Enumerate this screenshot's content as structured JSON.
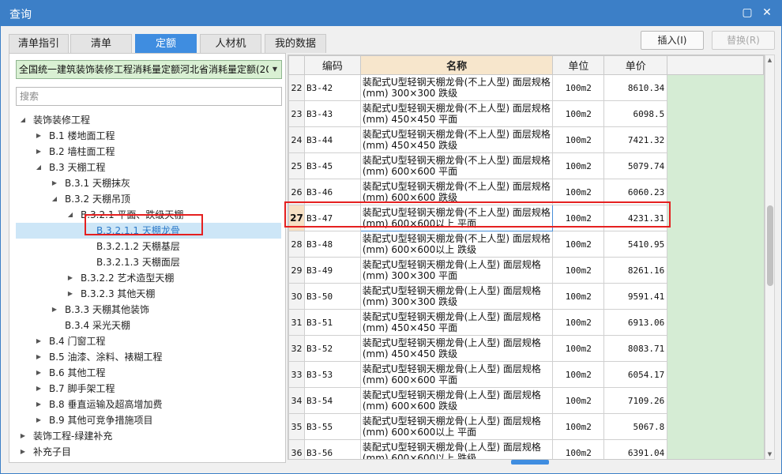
{
  "window": {
    "title": "查询",
    "restore_icon": "▢",
    "close_icon": "✕"
  },
  "tabs": [
    {
      "label": "清单指引",
      "active": false
    },
    {
      "label": "清单",
      "active": false
    },
    {
      "label": "定额",
      "active": true
    },
    {
      "label": "人材机",
      "active": false
    },
    {
      "label": "我的数据",
      "active": false
    }
  ],
  "actions": {
    "insert": "插入(I)",
    "replace": "替换(R)"
  },
  "left": {
    "library": "全国统一建筑装饰装修工程消耗量定额河北省消耗量定额(20",
    "search_placeholder": "搜索"
  },
  "tree": [
    {
      "label": "装饰装修工程",
      "level": 0,
      "state": "expanded"
    },
    {
      "label": "B.1 楼地面工程",
      "level": 1,
      "state": "collapsed"
    },
    {
      "label": "B.2 墙柱面工程",
      "level": 1,
      "state": "collapsed"
    },
    {
      "label": "B.3 天棚工程",
      "level": 1,
      "state": "expanded"
    },
    {
      "label": "B.3.1 天棚抹灰",
      "level": 2,
      "state": "collapsed"
    },
    {
      "label": "B.3.2 天棚吊顶",
      "level": 2,
      "state": "expanded"
    },
    {
      "label": "B.3.2.1 平面、跌级天棚",
      "level": 3,
      "state": "expanded"
    },
    {
      "label": "B.3.2.1.1 天棚龙骨",
      "level": 4,
      "state": "leaf",
      "selected": true
    },
    {
      "label": "B.3.2.1.2 天棚基层",
      "level": 4,
      "state": "leaf"
    },
    {
      "label": "B.3.2.1.3 天棚面层",
      "level": 4,
      "state": "leaf"
    },
    {
      "label": "B.3.2.2 艺术造型天棚",
      "level": 3,
      "state": "collapsed"
    },
    {
      "label": "B.3.2.3 其他天棚",
      "level": 3,
      "state": "collapsed"
    },
    {
      "label": "B.3.3 天棚其他装饰",
      "level": 2,
      "state": "collapsed"
    },
    {
      "label": "B.3.4 采光天棚",
      "level": 2,
      "state": "leaf"
    },
    {
      "label": "B.4 门窗工程",
      "level": 1,
      "state": "collapsed"
    },
    {
      "label": "B.5 油漆、涂料、裱糊工程",
      "level": 1,
      "state": "collapsed"
    },
    {
      "label": "B.6 其他工程",
      "level": 1,
      "state": "collapsed"
    },
    {
      "label": "B.7 脚手架工程",
      "level": 1,
      "state": "collapsed"
    },
    {
      "label": "B.8 垂直运输及超高增加费",
      "level": 1,
      "state": "collapsed"
    },
    {
      "label": "B.9 其他可竞争措施项目",
      "level": 1,
      "state": "collapsed"
    },
    {
      "label": "装饰工程-绿建补充",
      "level": 0,
      "state": "collapsed"
    },
    {
      "label": "补充子目",
      "level": 0,
      "state": "collapsed"
    }
  ],
  "grid": {
    "columns": {
      "code": "编码",
      "name": "名称",
      "unit": "单位",
      "price": "单价"
    },
    "rows": [
      {
        "idx": "22",
        "code": "B3-42",
        "name": "装配式U型轻钢天棚龙骨(不上人型) 面层规格(mm) 300×300 跌级",
        "unit": "100m2",
        "price": "8610.34"
      },
      {
        "idx": "23",
        "code": "B3-43",
        "name": "装配式U型轻钢天棚龙骨(不上人型) 面层规格(mm) 450×450 平面",
        "unit": "100m2",
        "price": "6098.5"
      },
      {
        "idx": "24",
        "code": "B3-44",
        "name": "装配式U型轻钢天棚龙骨(不上人型) 面层规格(mm) 450×450 跌级",
        "unit": "100m2",
        "price": "7421.32"
      },
      {
        "idx": "25",
        "code": "B3-45",
        "name": "装配式U型轻钢天棚龙骨(不上人型) 面层规格(mm) 600×600 平面",
        "unit": "100m2",
        "price": "5079.74"
      },
      {
        "idx": "26",
        "code": "B3-46",
        "name": "装配式U型轻钢天棚龙骨(不上人型) 面层规格(mm) 600×600 跌级",
        "unit": "100m2",
        "price": "6060.23"
      },
      {
        "idx": "27",
        "code": "B3-47",
        "name": "装配式U型轻钢天棚龙骨(不上人型) 面层规格(mm) 600×600以上 平面",
        "unit": "100m2",
        "price": "4231.31",
        "current": true
      },
      {
        "idx": "28",
        "code": "B3-48",
        "name": "装配式U型轻钢天棚龙骨(不上人型) 面层规格(mm) 600×600以上 跌级",
        "unit": "100m2",
        "price": "5410.95"
      },
      {
        "idx": "29",
        "code": "B3-49",
        "name": "装配式U型轻钢天棚龙骨(上人型) 面层规格(mm) 300×300 平面",
        "unit": "100m2",
        "price": "8261.16"
      },
      {
        "idx": "30",
        "code": "B3-50",
        "name": "装配式U型轻钢天棚龙骨(上人型) 面层规格(mm) 300×300 跌级",
        "unit": "100m2",
        "price": "9591.41"
      },
      {
        "idx": "31",
        "code": "B3-51",
        "name": "装配式U型轻钢天棚龙骨(上人型) 面层规格(mm) 450×450 平面",
        "unit": "100m2",
        "price": "6913.06"
      },
      {
        "idx": "32",
        "code": "B3-52",
        "name": "装配式U型轻钢天棚龙骨(上人型) 面层规格(mm) 450×450 跌级",
        "unit": "100m2",
        "price": "8083.71"
      },
      {
        "idx": "33",
        "code": "B3-53",
        "name": "装配式U型轻钢天棚龙骨(上人型) 面层规格(mm) 600×600 平面",
        "unit": "100m2",
        "price": "6054.17"
      },
      {
        "idx": "34",
        "code": "B3-54",
        "name": "装配式U型轻钢天棚龙骨(上人型) 面层规格(mm) 600×600 跌级",
        "unit": "100m2",
        "price": "7109.26"
      },
      {
        "idx": "35",
        "code": "B3-55",
        "name": "装配式U型轻钢天棚龙骨(上人型) 面层规格(mm) 600×600以上 平面",
        "unit": "100m2",
        "price": "5067.8"
      },
      {
        "idx": "36",
        "code": "B3-56",
        "name": "装配式U型轻钢天棚龙骨(上人型) 面层规格(mm) 600×600以上 跌级",
        "unit": "100m2",
        "price": "6391.04"
      }
    ]
  },
  "icons": {
    "expanded": "◢",
    "collapsed": "▶",
    "dropdown": "▼",
    "scroll_up": "▲",
    "scroll_down": "▼"
  }
}
